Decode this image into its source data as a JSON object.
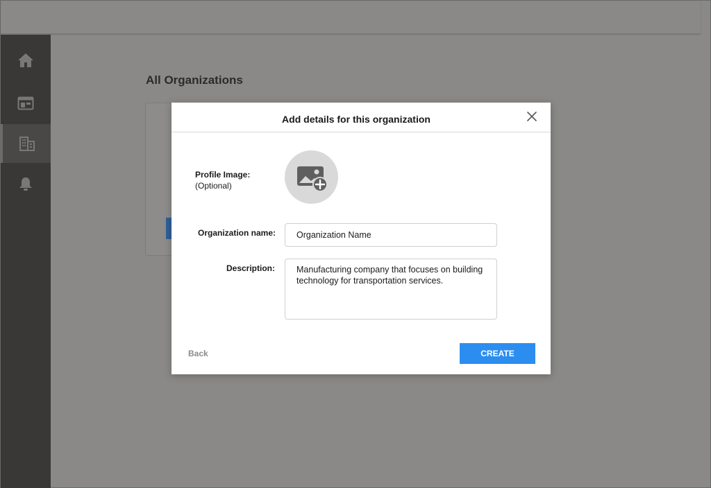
{
  "page": {
    "title": "All Organizations"
  },
  "sidebar": {
    "items": [
      {
        "icon": "home-icon",
        "active": false
      },
      {
        "icon": "dashboard-icon",
        "active": false
      },
      {
        "icon": "building-icon",
        "active": true
      },
      {
        "icon": "bell-icon",
        "active": false
      }
    ]
  },
  "modal": {
    "title": "Add details for this organization",
    "profile_label": "Profile Image:",
    "profile_optional": "(Optional)",
    "org_name_label": "Organization name:",
    "org_name_value": "Organization Name",
    "description_label": "Description:",
    "description_value": "Manufacturing company that focuses on building technology for transportation services.",
    "back_label": "Back",
    "create_label": "CREATE"
  },
  "colors": {
    "accent": "#2c8df0",
    "sidebar_bg": "#3a3836",
    "overlay": "#8a8987"
  }
}
